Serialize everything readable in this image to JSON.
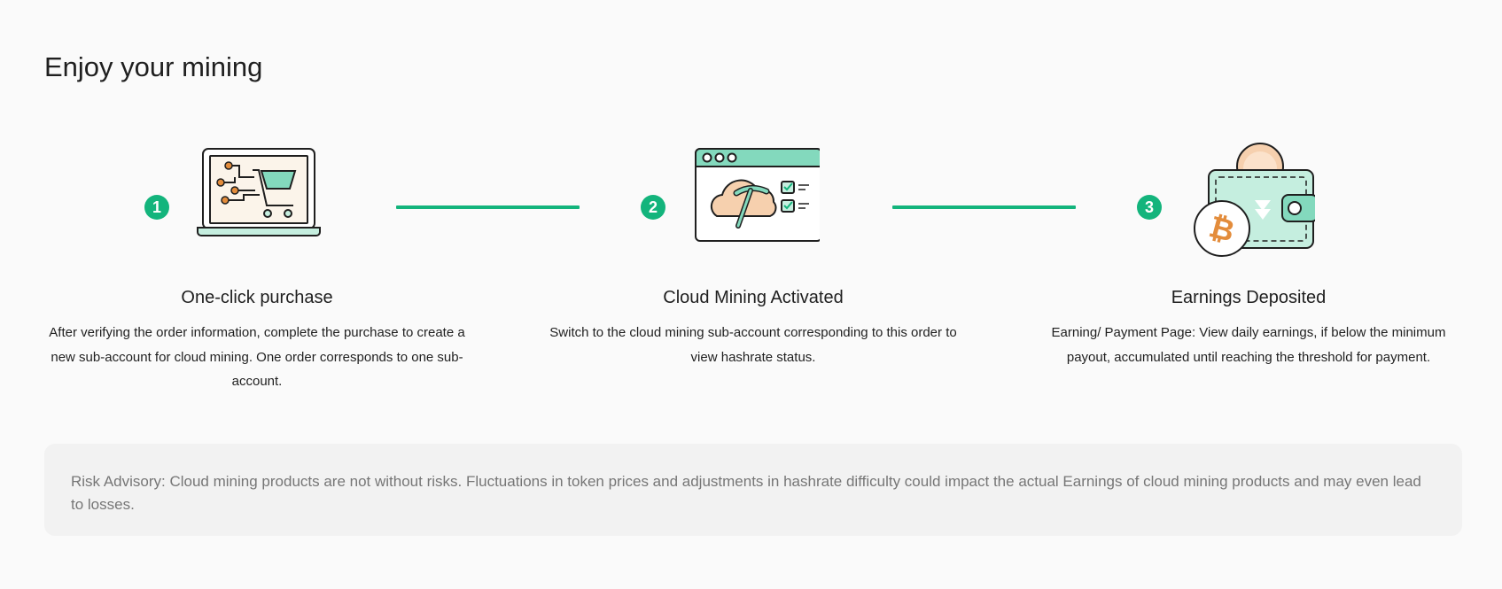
{
  "page": {
    "title": "Enjoy your mining"
  },
  "steps": [
    {
      "number": "1",
      "icon": "laptop-cart-icon",
      "title": "One-click purchase",
      "description": "After verifying the order information, complete the purchase to create a new sub-account for cloud mining. One order corresponds to one sub-account."
    },
    {
      "number": "2",
      "icon": "cloud-mining-window-icon",
      "title": "Cloud Mining Activated",
      "description": "Switch to the cloud mining sub-account corresponding to this order to view hashrate status."
    },
    {
      "number": "3",
      "icon": "wallet-bitcoin-icon",
      "title": "Earnings Deposited",
      "description": "Earning/ Payment Page: View daily earnings, if below the minimum payout, accumulated until reaching the threshold for payment."
    }
  ],
  "risk": {
    "text": "Risk Advisory: Cloud mining products are not without risks. Fluctuations in token prices and adjustments in hashrate difficulty could impact the actual Earnings of cloud mining products and may even lead to losses."
  },
  "colors": {
    "accent": "#13b47c",
    "icon_green": "#83d9bd",
    "icon_peach": "#f6d0ae",
    "icon_orange": "#e38c3b",
    "background": "#fafafa",
    "risk_background": "#f2f2f2"
  }
}
